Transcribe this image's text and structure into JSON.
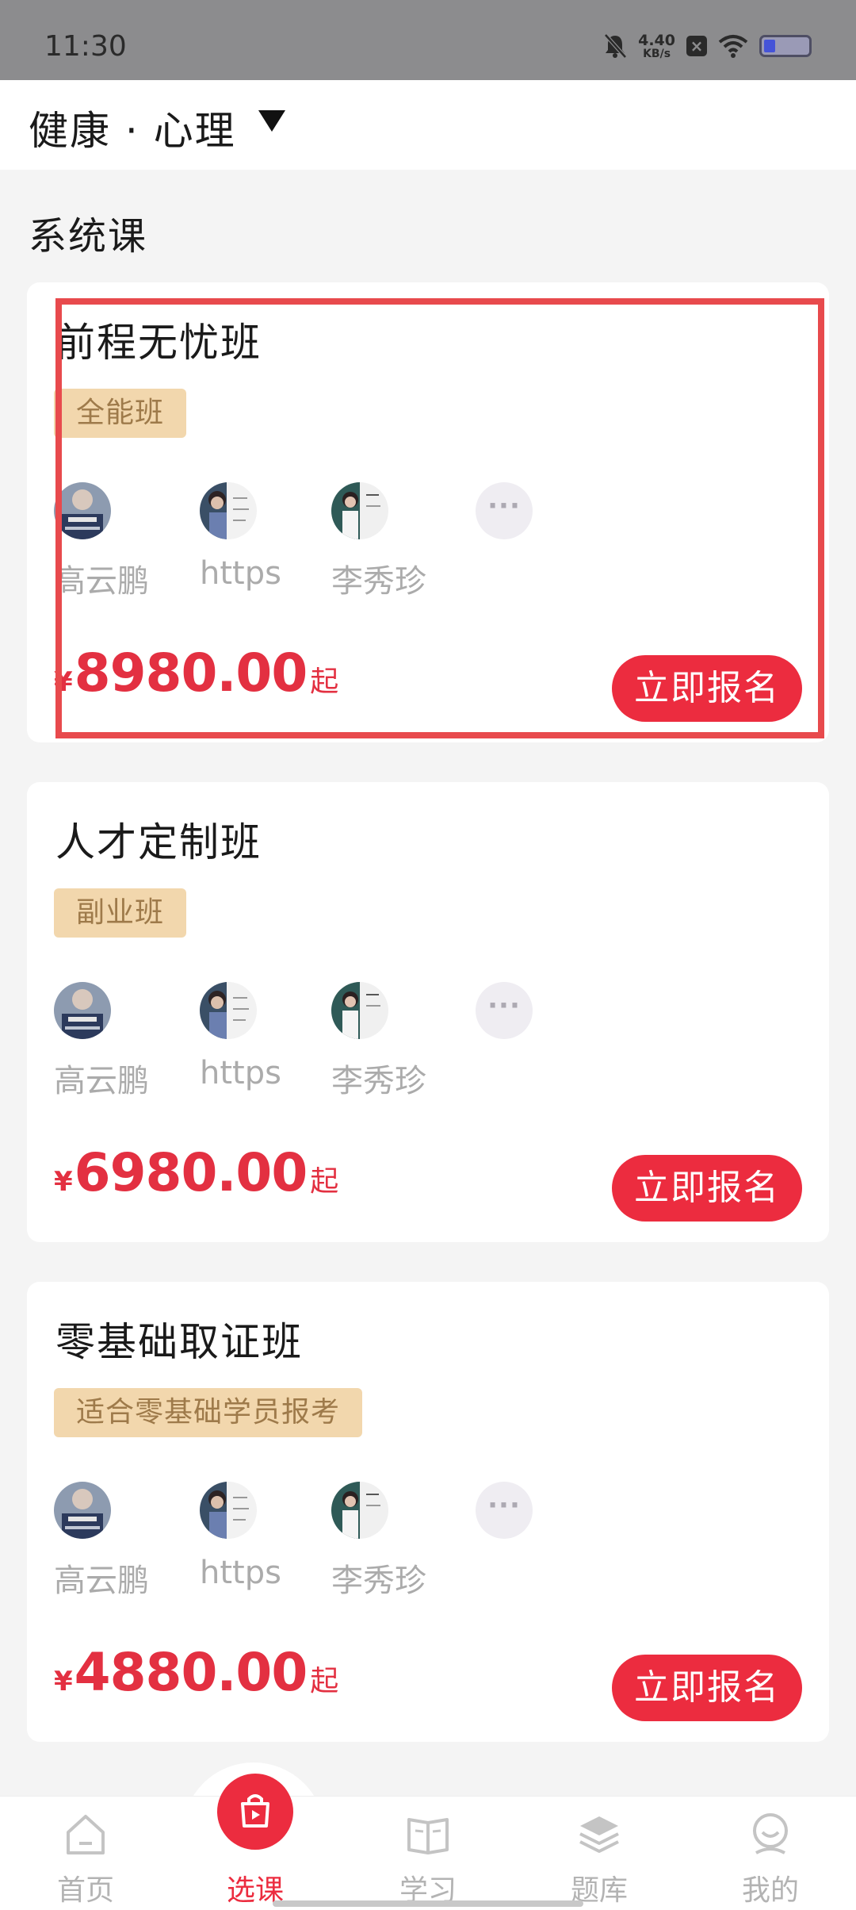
{
  "status_bar": {
    "time": "11:30",
    "net_speed_value": "4.40",
    "net_speed_unit": "KB/s",
    "icons": [
      "bell-off-icon",
      "x-box-icon",
      "wifi-icon",
      "battery-icon"
    ]
  },
  "header": {
    "title": "健康 · 心理",
    "caret_icon": "caret-down-icon"
  },
  "section": {
    "title": "系统课"
  },
  "cards": [
    {
      "title": "前程无忧班",
      "tag": "全能班",
      "teachers": [
        {
          "name": "高云鹏"
        },
        {
          "name": "https"
        },
        {
          "name": "李秀珍"
        }
      ],
      "more_label": "···",
      "price_symbol": "¥",
      "price": "8980.00",
      "price_suffix": "起",
      "enroll_label": "立即报名"
    },
    {
      "title": "人才定制班",
      "tag": "副业班",
      "teachers": [
        {
          "name": "高云鹏"
        },
        {
          "name": "https"
        },
        {
          "name": "李秀珍"
        }
      ],
      "more_label": "···",
      "price_symbol": "¥",
      "price": "6980.00",
      "price_suffix": "起",
      "enroll_label": "立即报名"
    },
    {
      "title": "零基础取证班",
      "tag": "适合零基础学员报考",
      "teachers": [
        {
          "name": "高云鹏"
        },
        {
          "name": "https"
        },
        {
          "name": "李秀珍"
        }
      ],
      "more_label": "···",
      "price_symbol": "¥",
      "price": "4880.00",
      "price_suffix": "起",
      "enroll_label": "立即报名"
    }
  ],
  "bottom_nav": [
    {
      "label": "首页",
      "icon": "home-icon",
      "active": false
    },
    {
      "label": "选课",
      "icon": "shopping-bag-icon",
      "active": true
    },
    {
      "label": "学习",
      "icon": "book-icon",
      "active": false
    },
    {
      "label": "题库",
      "icon": "layers-icon",
      "active": false
    },
    {
      "label": "我的",
      "icon": "profile-icon",
      "active": false
    }
  ],
  "colors": {
    "accent": "#ec2c3f",
    "tag_bg": "#f2d7ad",
    "tag_text": "#9e7a4a",
    "highlight": "#e84a4d"
  }
}
